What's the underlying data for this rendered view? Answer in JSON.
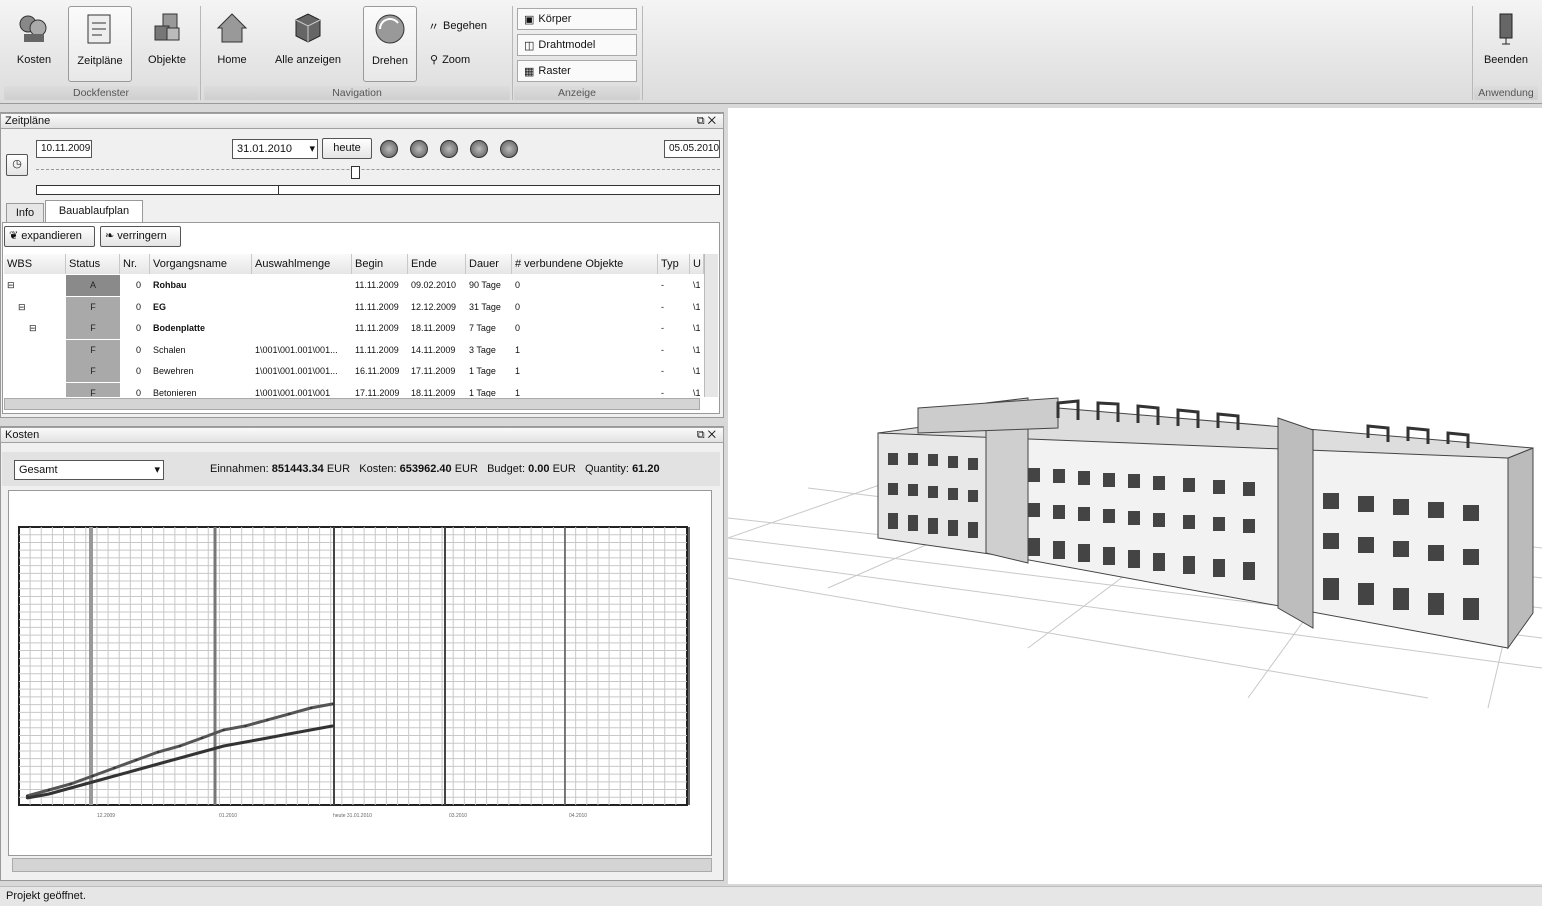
{
  "ribbon": {
    "buttons": [
      {
        "label": "Kosten",
        "icon": "coins-icon"
      },
      {
        "label": "Zeitpläne",
        "icon": "schedule-icon"
      },
      {
        "label": "Objekte",
        "icon": "cubes-icon"
      },
      {
        "label": "Home",
        "icon": "home-icon"
      },
      {
        "label": "Alle anzeigen",
        "icon": "cube-icon"
      },
      {
        "label": "Drehen",
        "icon": "rotate-icon"
      }
    ],
    "begehen": "Begehen",
    "zoom": "Zoom",
    "anzeige": [
      "Körper",
      "Drahtmodel",
      "Raster"
    ],
    "beenden": "Beenden",
    "groups": [
      "Dockfenster",
      "Navigation",
      "Anzeige",
      "Anwendung"
    ]
  },
  "zeitplaene": {
    "title": "Zeitpläne",
    "start_date": "10.11.2009",
    "current_date": "31.01.2010",
    "today_button": "heute",
    "end_date": "05.05.2010",
    "tabs": [
      "Info",
      "Bauablaufplan"
    ],
    "expand": "expandieren",
    "reduce": "verringern",
    "columns": [
      "WBS",
      "Status",
      "Nr.",
      "Vorgangsname",
      "Auswahlmenge",
      "Begin",
      "Ende",
      "Dauer",
      "# verbundene Objekte",
      "Typ",
      "U"
    ],
    "rows": [
      {
        "tree": "⊟",
        "status": "A",
        "nr": "0",
        "name": "Rohbau",
        "auswahl": "",
        "begin": "11.11.2009",
        "ende": "09.02.2010",
        "dauer": "90 Tage",
        "obj": "0",
        "typ": "-",
        "u": "\\1"
      },
      {
        "tree": "⊟",
        "status": "F",
        "nr": "0",
        "name": "EG",
        "auswahl": "",
        "begin": "11.11.2009",
        "ende": "12.12.2009",
        "dauer": "31 Tage",
        "obj": "0",
        "typ": "-",
        "u": "\\1"
      },
      {
        "tree": "⊟",
        "status": "F",
        "nr": "0",
        "name": "Bodenplatte",
        "auswahl": "",
        "begin": "11.11.2009",
        "ende": "18.11.2009",
        "dauer": "7 Tage",
        "obj": "0",
        "typ": "-",
        "u": "\\1"
      },
      {
        "tree": "",
        "status": "F",
        "nr": "0",
        "name": "Schalen",
        "auswahl": "1\\001\\001.001\\001...",
        "begin": "11.11.2009",
        "ende": "14.11.2009",
        "dauer": "3 Tage",
        "obj": "1",
        "typ": "-",
        "u": "\\1"
      },
      {
        "tree": "",
        "status": "F",
        "nr": "0",
        "name": "Bewehren",
        "auswahl": "1\\001\\001.001\\001...",
        "begin": "16.11.2009",
        "ende": "17.11.2009",
        "dauer": "1 Tage",
        "obj": "1",
        "typ": "-",
        "u": "\\1"
      },
      {
        "tree": "",
        "status": "F",
        "nr": "0",
        "name": "Betonieren",
        "auswahl": "1\\001\\001.001\\001",
        "begin": "17.11.2009",
        "ende": "18.11.2009",
        "dauer": "1 Tage",
        "obj": "1",
        "typ": "-",
        "u": "\\1"
      }
    ]
  },
  "kosten": {
    "title": "Kosten",
    "select_value": "Gesamt",
    "einnahmen_label": "Einnahmen:",
    "einnahmen_value": "851443.34",
    "kosten_label": "Kosten:",
    "kosten_value": "653962.40",
    "budget_label": "Budget:",
    "budget_value": "0.00",
    "quantity_label": "Quantity:",
    "quantity_value": "61.20",
    "currency": "EUR",
    "x_ticks": [
      "12.2009",
      "01.2010",
      "heute 31.01.2010",
      "03.2010",
      "04.2010"
    ]
  },
  "chart_data": {
    "type": "line",
    "series": [
      {
        "values": [
          0.02,
          0.05,
          0.08,
          0.12,
          0.16,
          0.2,
          0.24,
          0.27,
          0.31,
          0.35,
          0.37,
          0.4,
          0.43,
          0.46,
          0.48
        ]
      },
      {
        "values": [
          0.01,
          0.03,
          0.06,
          0.09,
          0.12,
          0.15,
          0.18,
          0.21,
          0.24,
          0.27,
          0.29,
          0.31,
          0.33,
          0.35,
          0.37
        ]
      }
    ]
  },
  "statusbar": "Projekt geöffnet."
}
